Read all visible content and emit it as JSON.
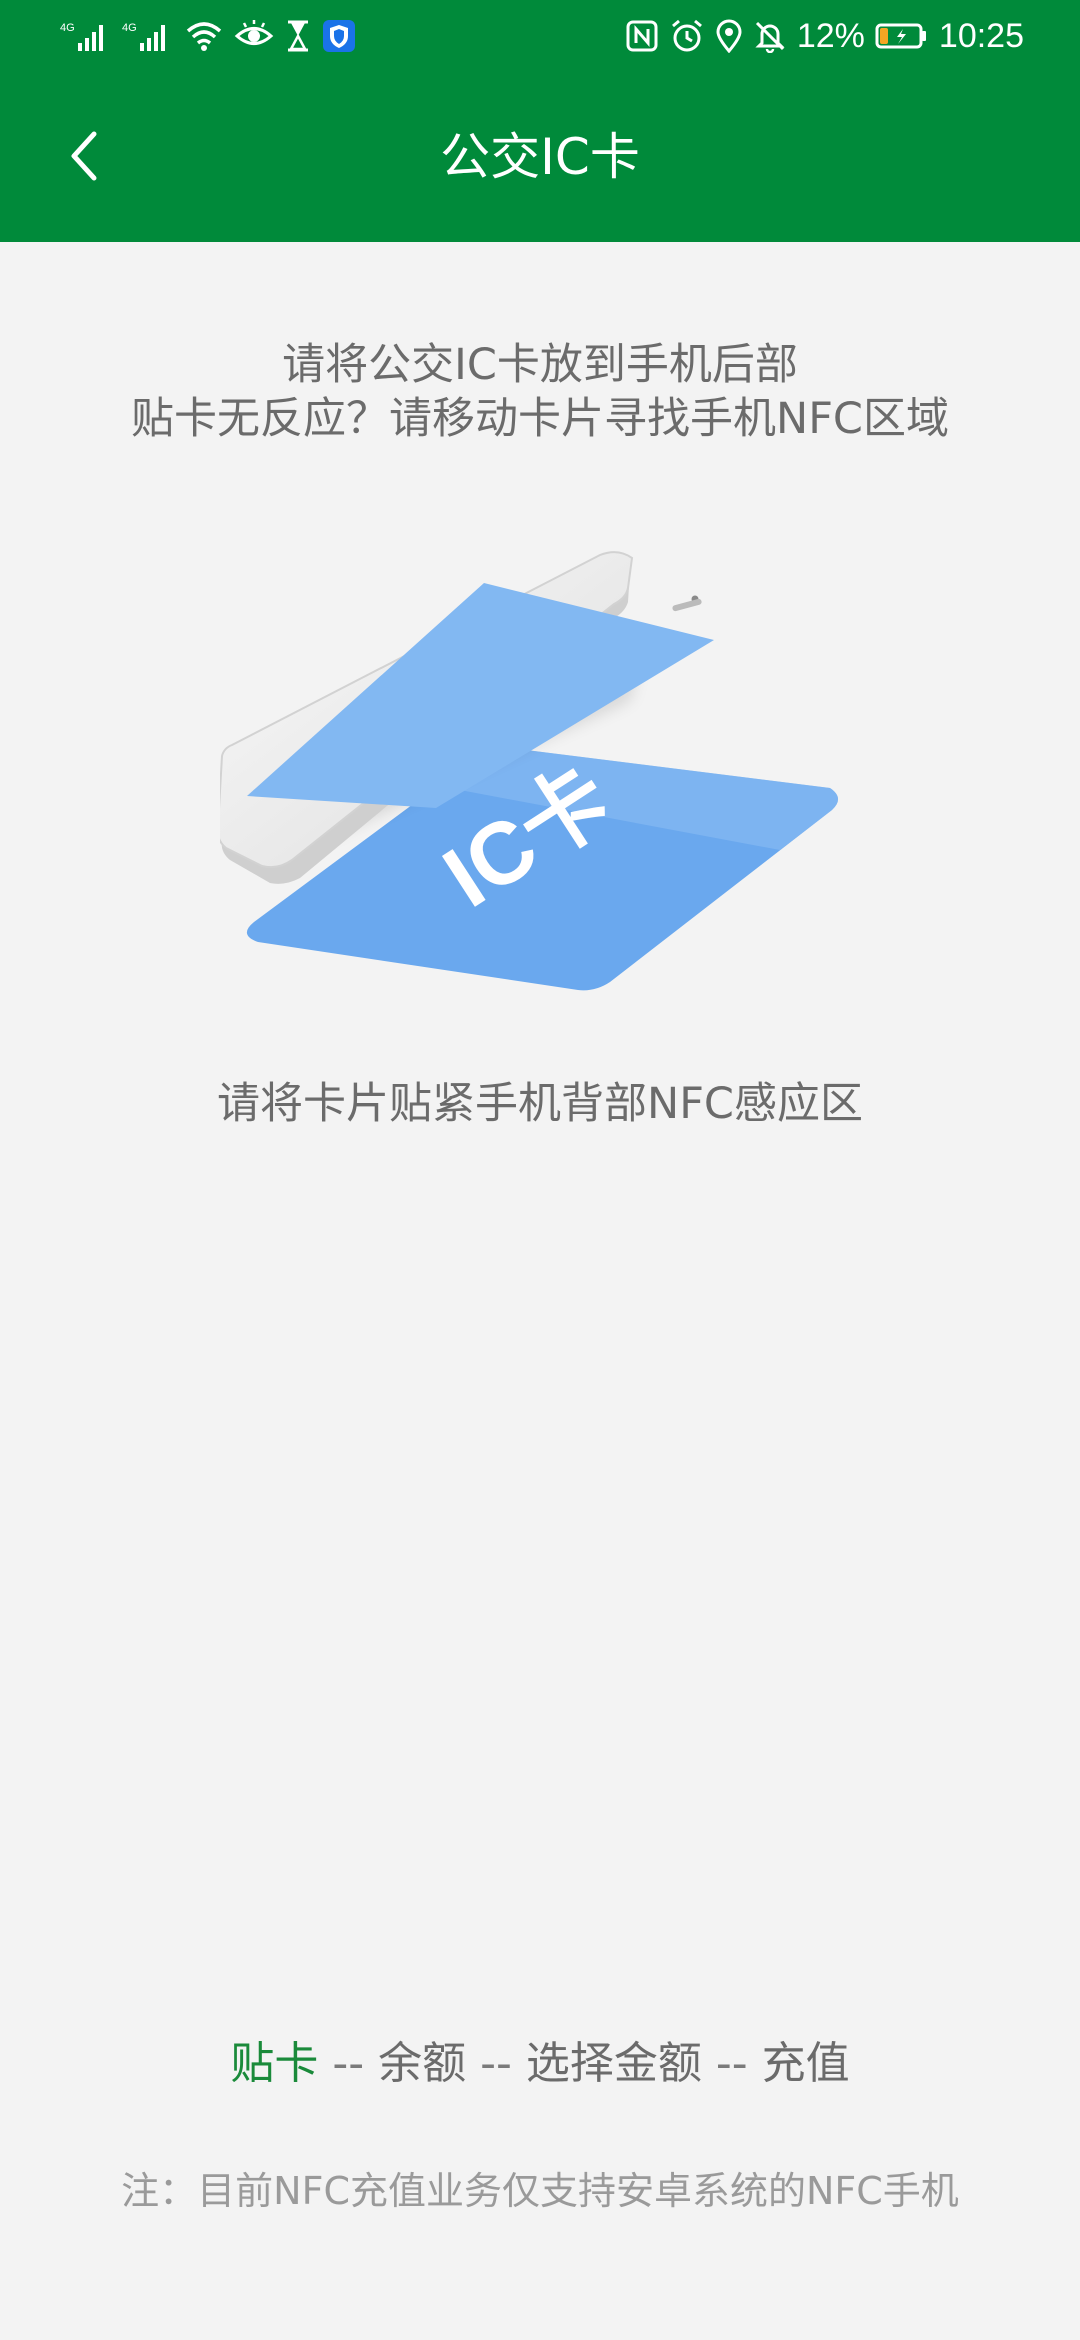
{
  "status_bar": {
    "network_1": "4G",
    "network_2": "4G",
    "battery_percent": "12%",
    "time": "10:25",
    "icons_left": [
      "signal-icon",
      "signal-icon",
      "wifi-icon",
      "eye-icon",
      "hourglass-icon",
      "shield-icon"
    ],
    "icons_right": [
      "nfc-icon",
      "alarm-icon",
      "location-icon",
      "bell-off-icon",
      "battery-icon"
    ]
  },
  "nav": {
    "back_icon": "chevron-left-icon",
    "title": "公交IC卡"
  },
  "instructions": {
    "line1": "请将公交IC卡放到手机后部",
    "line2": "贴卡无反应？请移动卡片寻找手机NFC区域"
  },
  "illustration": {
    "card_label": "IC卡"
  },
  "tap_hint": "请将卡片贴紧手机背部NFC感应区",
  "steps": {
    "items": [
      "贴卡",
      "余额",
      "选择金额",
      "充值"
    ],
    "separator": " -- ",
    "active_index": 0
  },
  "note": "注：目前NFC充值业务仅支持安卓系统的NFC手机",
  "colors": {
    "header_bg": "#008a3a",
    "page_bg": "#f3f3f3",
    "active_step": "#1a8a3a",
    "text": "#6b6b6b",
    "note_text": "#9a9a9a",
    "phone_screen": "#82b8f2",
    "card": "#6aa8ee"
  }
}
